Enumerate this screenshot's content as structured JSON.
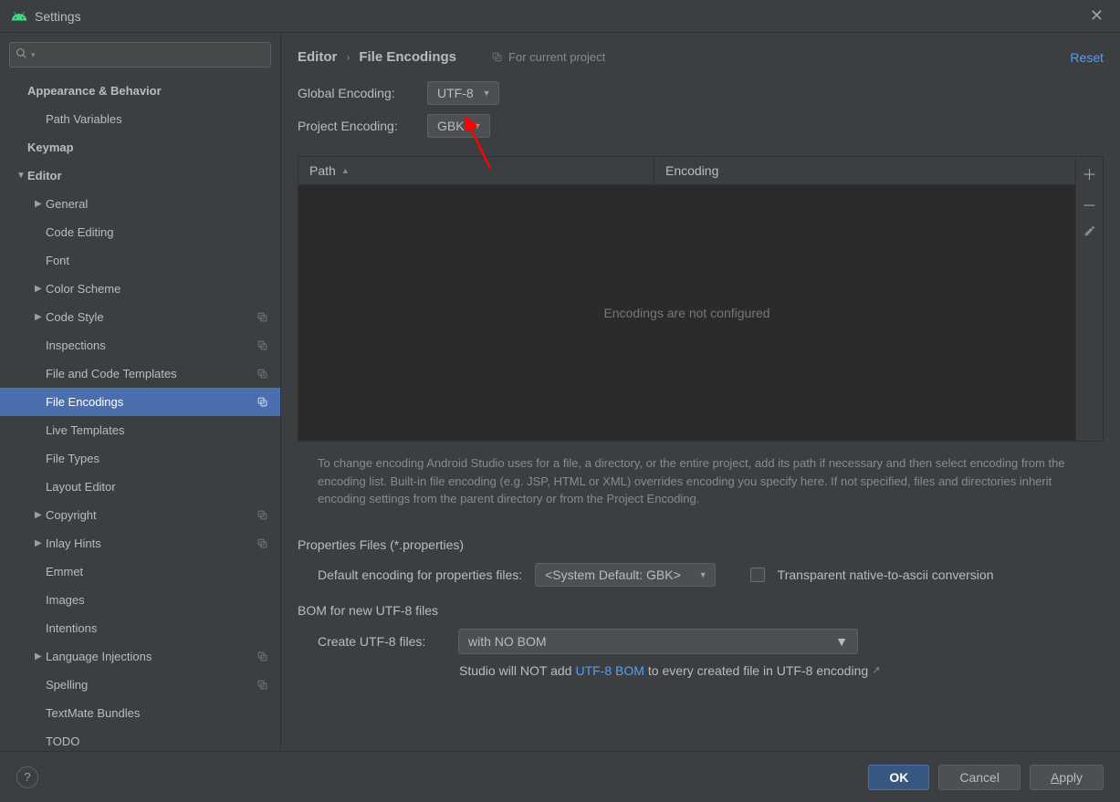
{
  "window": {
    "title": "Settings"
  },
  "breadcrumb": {
    "part1": "Editor",
    "part2": "File Encodings",
    "scope": "For current project",
    "reset": "Reset"
  },
  "sidebar": {
    "search_placeholder": "",
    "items": [
      {
        "label": "Appearance & Behavior",
        "bold": true,
        "arrow": "none",
        "indent": 0
      },
      {
        "label": "Path Variables",
        "arrow": "none",
        "indent": 1
      },
      {
        "label": "Keymap",
        "bold": true,
        "arrow": "none",
        "indent": 0
      },
      {
        "label": "Editor",
        "bold": true,
        "arrow": "open",
        "indent": 0
      },
      {
        "label": "General",
        "arrow": "closed",
        "indent": 1
      },
      {
        "label": "Code Editing",
        "arrow": "none",
        "indent": 1
      },
      {
        "label": "Font",
        "arrow": "none",
        "indent": 1
      },
      {
        "label": "Color Scheme",
        "arrow": "closed",
        "indent": 1
      },
      {
        "label": "Code Style",
        "arrow": "closed",
        "indent": 1,
        "badge": true
      },
      {
        "label": "Inspections",
        "arrow": "none",
        "indent": 1,
        "badge": true
      },
      {
        "label": "File and Code Templates",
        "arrow": "none",
        "indent": 1,
        "badge": true
      },
      {
        "label": "File Encodings",
        "arrow": "none",
        "indent": 1,
        "badge": true,
        "selected": true
      },
      {
        "label": "Live Templates",
        "arrow": "none",
        "indent": 1
      },
      {
        "label": "File Types",
        "arrow": "none",
        "indent": 1
      },
      {
        "label": "Layout Editor",
        "arrow": "none",
        "indent": 1
      },
      {
        "label": "Copyright",
        "arrow": "closed",
        "indent": 1,
        "badge": true
      },
      {
        "label": "Inlay Hints",
        "arrow": "closed",
        "indent": 1,
        "badge": true
      },
      {
        "label": "Emmet",
        "arrow": "none",
        "indent": 1
      },
      {
        "label": "Images",
        "arrow": "none",
        "indent": 1
      },
      {
        "label": "Intentions",
        "arrow": "none",
        "indent": 1
      },
      {
        "label": "Language Injections",
        "arrow": "closed",
        "indent": 1,
        "badge": true
      },
      {
        "label": "Spelling",
        "arrow": "none",
        "indent": 1,
        "badge": true
      },
      {
        "label": "TextMate Bundles",
        "arrow": "none",
        "indent": 1
      },
      {
        "label": "TODO",
        "arrow": "none",
        "indent": 1
      }
    ]
  },
  "form": {
    "global_label": "Global Encoding:",
    "global_value": "UTF-8",
    "project_label": "Project Encoding:",
    "project_value": "GBK"
  },
  "table": {
    "col_path": "Path",
    "col_encoding": "Encoding",
    "empty": "Encodings are not configured"
  },
  "help_text": "To change encoding Android Studio uses for a file, a directory, or the entire project, add its path if necessary and then select encoding from the encoding list. Built-in file encoding (e.g. JSP, HTML or XML) overrides encoding you specify here. If not specified, files and directories inherit encoding settings from the parent directory or from the Project Encoding.",
  "properties": {
    "title": "Properties Files (*.properties)",
    "default_label": "Default encoding for properties files:",
    "default_value": "<System Default: GBK>",
    "transparent": "Transparent native-to-ascii conversion"
  },
  "bom": {
    "title": "BOM for new UTF-8 files",
    "create_label": "Create UTF-8 files:",
    "create_value": "with NO BOM",
    "note_pre": "Studio will NOT add ",
    "note_link": "UTF-8 BOM",
    "note_post": " to every created file in UTF-8 encoding"
  },
  "footer": {
    "ok": "OK",
    "cancel": "Cancel",
    "apply": "Apply"
  }
}
